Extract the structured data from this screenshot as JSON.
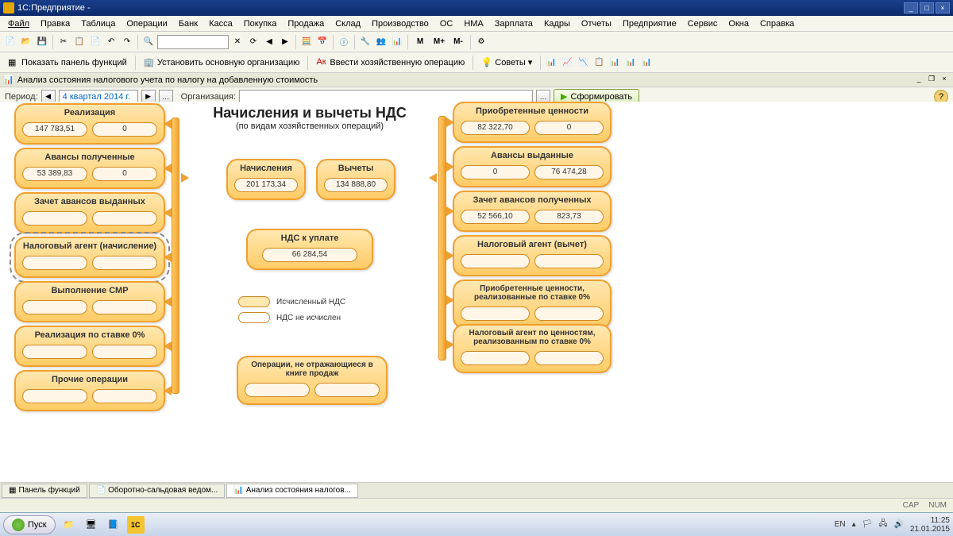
{
  "title_app": "1С:Предприятие - ",
  "menu": [
    "Файл",
    "Правка",
    "Таблица",
    "Операции",
    "Банк",
    "Касса",
    "Покупка",
    "Продажа",
    "Склад",
    "Производство",
    "ОС",
    "НМА",
    "Зарплата",
    "Кадры",
    "Отчеты",
    "Предприятие",
    "Сервис",
    "Окна",
    "Справка"
  ],
  "toolbar2": {
    "show_panel": "Показать панель функций",
    "set_org": "Установить основную организацию",
    "enter_op": "Ввести хозяйственную операцию",
    "tips": "Советы"
  },
  "m_buttons": [
    "M",
    "M+",
    "M-"
  ],
  "doc_title": "Анализ состояния налогового учета по налогу на добавленную стоимость",
  "period": {
    "label": "Период:",
    "value": "4 квартал 2014 г.",
    "org_label": "Организация:",
    "org_value": "",
    "run": "Сформировать"
  },
  "center": {
    "title": "Начисления и вычеты НДС",
    "subtitle": "(по видам хозяйственных операций)"
  },
  "legend": {
    "filled": "Исчисленный НДС",
    "empty": "НДС не исчислен"
  },
  "left_blocks": [
    {
      "title": "Реализация",
      "v1": "147 783,51",
      "v2": "0"
    },
    {
      "title": "Авансы полученные",
      "v1": "53 389,83",
      "v2": "0"
    },
    {
      "title": "Зачет авансов выданных",
      "v1": "",
      "v2": ""
    },
    {
      "title": "Налоговый агент (начисление)",
      "v1": "",
      "v2": "",
      "selected": true
    },
    {
      "title": "Выполнение СМР",
      "v1": "",
      "v2": ""
    },
    {
      "title": "Реализация по ставке 0%",
      "v1": "",
      "v2": ""
    },
    {
      "title": "Прочие операции",
      "v1": "",
      "v2": ""
    }
  ],
  "right_blocks": [
    {
      "title": "Приобретенные ценности",
      "v1": "82 322,70",
      "v2": "0"
    },
    {
      "title": "Авансы выданные",
      "v1": "0",
      "v2": "76 474,28"
    },
    {
      "title": "Зачет авансов полученных",
      "v1": "52 566,10",
      "v2": "823,73"
    },
    {
      "title": "Налоговый агент (вычет)",
      "v1": "",
      "v2": ""
    },
    {
      "title": "Приобретенные ценности, реализованные по ставке 0%",
      "v1": "",
      "v2": "",
      "small": true
    },
    {
      "title": "Налоговый агент по ценностям, реализованным по ставке 0%",
      "v1": "",
      "v2": "",
      "small": true
    }
  ],
  "mid_blocks": {
    "charges": {
      "title": "Начисления",
      "val": "201 173,34"
    },
    "deductions": {
      "title": "Вычеты",
      "val": "134 888,80"
    },
    "payable": {
      "title": "НДС к уплате",
      "val": "66 284,54"
    },
    "not_in_book": {
      "title": "Операции, не отражающиеся в книге продаж",
      "v1": "",
      "v2": ""
    }
  },
  "tabs": [
    "Панель функций",
    "Оборотно-сальдовая ведом...",
    "Анализ состояния налогов..."
  ],
  "status": {
    "cap": "CAP",
    "num": "NUM"
  },
  "taskbar": {
    "start": "Пуск",
    "lang": "EN",
    "time": "11:25",
    "date": "21.01.2015"
  }
}
